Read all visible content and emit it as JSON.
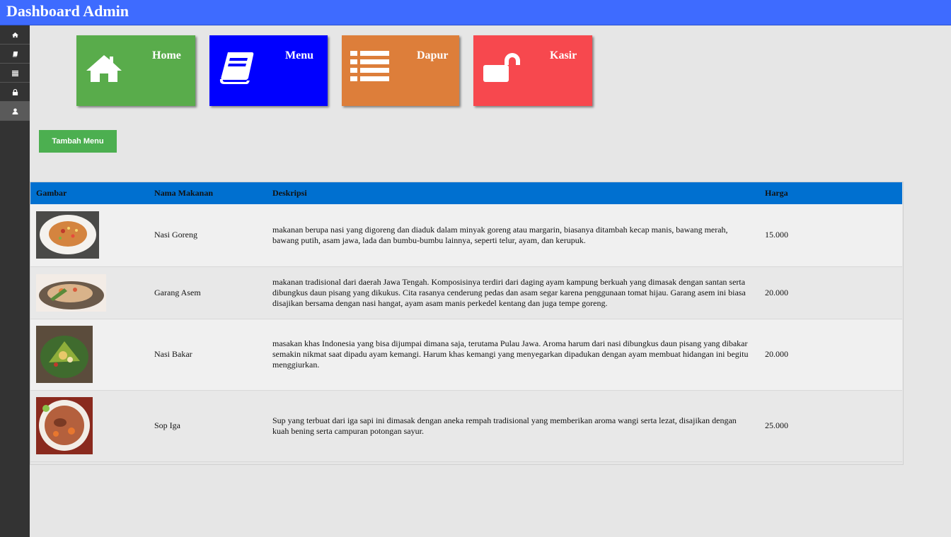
{
  "header": {
    "title": "Dashboard Admin"
  },
  "sidebar": {
    "items": [
      {
        "icon": "home-icon"
      },
      {
        "icon": "book-icon"
      },
      {
        "icon": "list-icon"
      },
      {
        "icon": "lock-icon"
      },
      {
        "icon": "user-icon"
      }
    ]
  },
  "tiles": [
    {
      "label": "Home",
      "icon": "home-icon",
      "color": "#59ac4b"
    },
    {
      "label": "Menu",
      "icon": "book-icon",
      "color": "#0000ff"
    },
    {
      "label": "Dapur",
      "icon": "list-icon",
      "color": "#dd7e3a"
    },
    {
      "label": "Kasir",
      "icon": "unlock-icon",
      "color": "#f7484e"
    }
  ],
  "actions": {
    "add_menu": "Tambah Menu"
  },
  "table": {
    "headers": {
      "image": "Gambar",
      "name": "Nama Makanan",
      "description": "Deskripsi",
      "price": "Harga"
    },
    "header_color": "#0070d0",
    "rows": [
      {
        "name": "Nasi Goreng",
        "description": "makanan berupa nasi yang digoreng dan diaduk dalam minyak goreng atau margarin, biasanya ditambah kecap manis, bawang merah, bawang putih, asam jawa, lada dan bumbu-bumbu lainnya, seperti telur, ayam, dan kerupuk.",
        "price": "15.000"
      },
      {
        "name": "Garang Asem",
        "description": "makanan tradisional dari daerah Jawa Tengah. Komposisinya terdiri dari daging ayam kampung berkuah yang dimasak dengan santan serta dibungkus daun pisang yang dikukus. Cita rasanya cenderung pedas dan asam segar karena penggunaan tomat hijau. Garang asem ini biasa disajikan bersama dengan nasi hangat, ayam asam manis perkedel kentang dan juga tempe goreng.",
        "price": "20.000"
      },
      {
        "name": "Nasi Bakar",
        "description": "masakan khas Indonesia yang bisa dijumpai dimana saja, terutama Pulau Jawa. Aroma harum dari nasi dibungkus daun pisang yang dibakar semakin nikmat saat dipadu ayam kemangi. Harum khas kemangi yang menyegarkan dipadukan dengan ayam membuat hidangan ini begitu menggiurkan.",
        "price": "20.000"
      },
      {
        "name": "Sop Iga",
        "description": "Sup yang terbuat dari iga sapi ini dimasak dengan aneka rempah tradisional yang memberikan aroma wangi serta lezat, disajikan dengan kuah bening serta campuran potongan sayur.",
        "price": "25.000"
      }
    ]
  }
}
